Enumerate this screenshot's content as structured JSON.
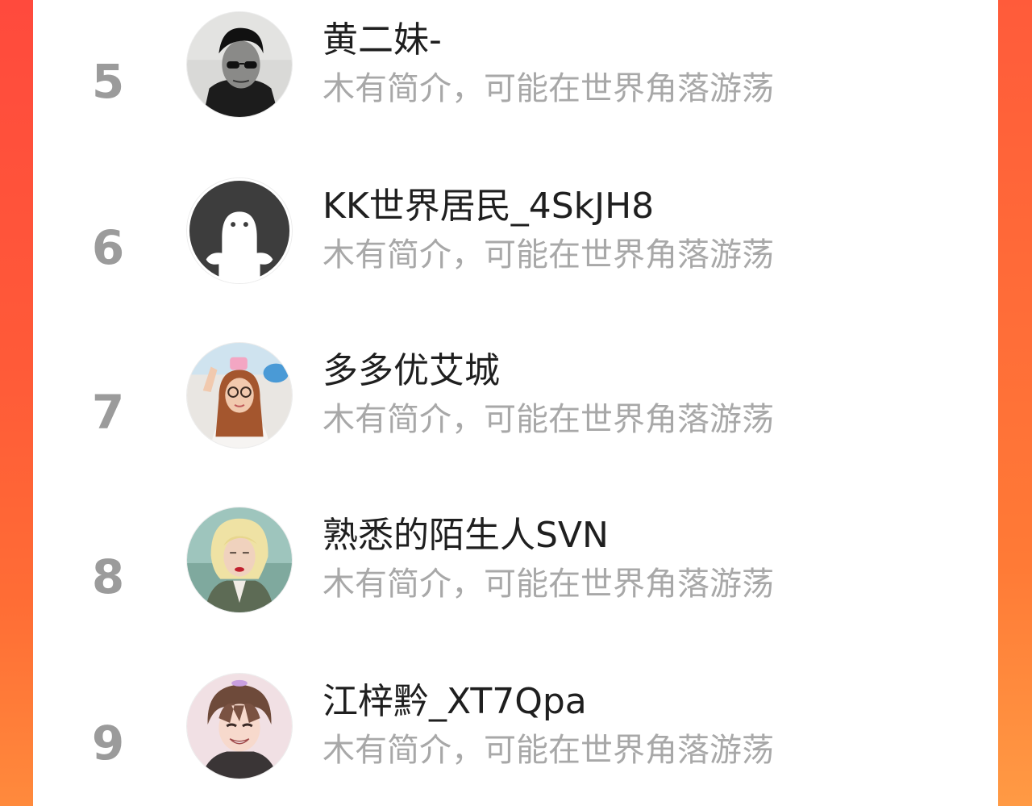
{
  "colors": {
    "background_gradient_top": "#ff4a3d",
    "background_gradient_bottom": "#ff8a3c",
    "panel": "#ffffff",
    "rank_text": "#9b9b9b",
    "name_text": "#1f1f1f",
    "intro_text": "#a8a8a8"
  },
  "ranking": {
    "entries": [
      {
        "rank": "5",
        "name": "黄二妹-",
        "intro": "木有简介，可能在世界角落游荡",
        "avatar_icon": "avatar-photo-man-sunglasses"
      },
      {
        "rank": "6",
        "name": "KK世界居民_4SkJH8",
        "intro": "木有简介，可能在世界角落游荡",
        "avatar_icon": "avatar-default-silhouette"
      },
      {
        "rank": "7",
        "name": "多多优艾城",
        "intro": "木有简介，可能在世界角落游荡",
        "avatar_icon": "avatar-photo-girl-glasses"
      },
      {
        "rank": "8",
        "name": "熟悉的陌生人SVN",
        "intro": "木有简介，可能在世界角落游荡",
        "avatar_icon": "avatar-photo-blonde-woman"
      },
      {
        "rank": "9",
        "name": "江梓黔_XT7Qpa",
        "intro": "木有简介，可能在世界角落游荡",
        "avatar_icon": "avatar-anime-boy"
      }
    ]
  }
}
